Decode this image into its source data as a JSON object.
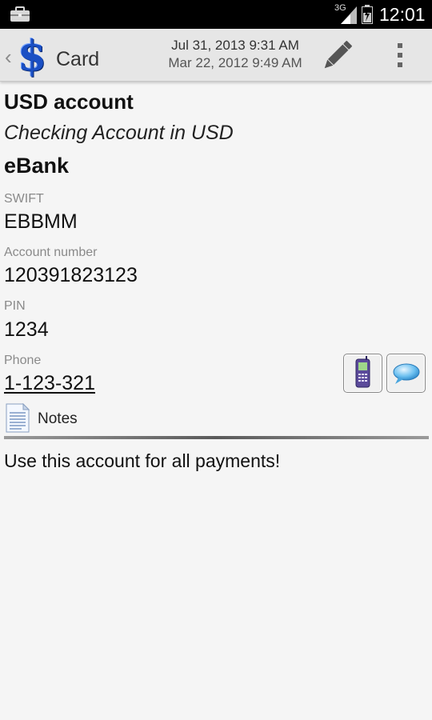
{
  "status_bar": {
    "network": "3G",
    "time": "12:01",
    "icons": [
      "briefcase-icon",
      "signal-icon",
      "battery-icon"
    ]
  },
  "action_bar": {
    "title": "Card",
    "created": "Jul 31, 2013 9:31 AM",
    "modified": "Mar 22, 2012 9:49 AM",
    "icons": [
      "back-caret-icon",
      "dollar-app-icon",
      "pencil-edit-icon",
      "overflow-menu-icon"
    ]
  },
  "card": {
    "name": "USD account",
    "description": "Checking Account in USD",
    "bank": "eBank",
    "fields": [
      {
        "label": "SWIFT",
        "value": "EBBMM"
      },
      {
        "label": "Account number",
        "value": "120391823123"
      },
      {
        "label": "PIN",
        "value": "1234"
      },
      {
        "label": "Phone",
        "value": "1-123-321"
      }
    ],
    "phone_actions": [
      "cellphone-icon",
      "speech-bubble-icon"
    ],
    "notes_label": "Notes",
    "notes_text": "Use this account for all payments!"
  },
  "colors": {
    "status_bar": "#000000",
    "action_bar": "#e6e6e6",
    "background": "#f5f5f5",
    "dollar_accent": "#1a4fc4"
  }
}
